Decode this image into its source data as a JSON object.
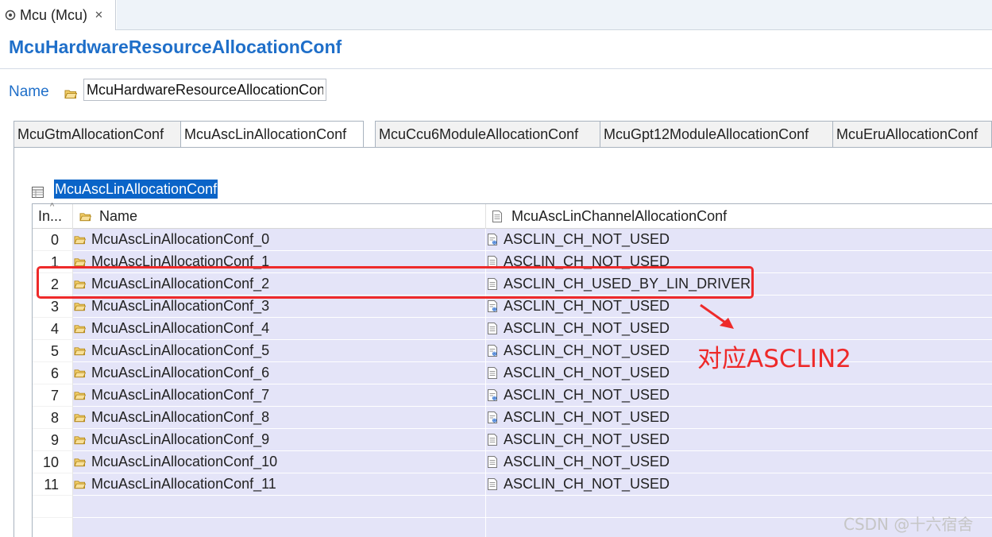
{
  "editor_tab": {
    "label": "Mcu (Mcu)",
    "close": "✕"
  },
  "page": {
    "title": "McuHardwareResourceAllocationConf"
  },
  "name_field": {
    "label": "Name",
    "value": "McuHardwareResourceAllocationConf"
  },
  "subtabs": [
    {
      "label": "McuGtmAllocationConf",
      "active": false
    },
    {
      "label": "McuAscLinAllocationConf",
      "active": true
    },
    {
      "label": "McuCcu6ModuleAllocationConf",
      "active": false
    },
    {
      "label": "McuGpt12ModuleAllocationConf",
      "active": false
    },
    {
      "label": "McuEruAllocationConf",
      "active": false
    }
  ],
  "section": {
    "title": "McuAscLinAllocationConf"
  },
  "table": {
    "columns": [
      "In...",
      "Name",
      "McuAscLinChannelAllocationConf"
    ],
    "rows": [
      {
        "index": "0",
        "name": "McuAscLinAllocationConf_0",
        "value": "ASCLIN_CH_NOT_USED",
        "icon": "document-default-icon"
      },
      {
        "index": "1",
        "name": "McuAscLinAllocationConf_1",
        "value": "ASCLIN_CH_NOT_USED",
        "icon": "document-icon"
      },
      {
        "index": "2",
        "name": "McuAscLinAllocationConf_2",
        "value": "ASCLIN_CH_USED_BY_LIN_DRIVER",
        "icon": "document-icon"
      },
      {
        "index": "3",
        "name": "McuAscLinAllocationConf_3",
        "value": "ASCLIN_CH_NOT_USED",
        "icon": "document-default-icon"
      },
      {
        "index": "4",
        "name": "McuAscLinAllocationConf_4",
        "value": "ASCLIN_CH_NOT_USED",
        "icon": "document-icon"
      },
      {
        "index": "5",
        "name": "McuAscLinAllocationConf_5",
        "value": "ASCLIN_CH_NOT_USED",
        "icon": "document-default-icon"
      },
      {
        "index": "6",
        "name": "McuAscLinAllocationConf_6",
        "value": "ASCLIN_CH_NOT_USED",
        "icon": "document-icon"
      },
      {
        "index": "7",
        "name": "McuAscLinAllocationConf_7",
        "value": "ASCLIN_CH_NOT_USED",
        "icon": "document-default-icon"
      },
      {
        "index": "8",
        "name": "McuAscLinAllocationConf_8",
        "value": "ASCLIN_CH_NOT_USED",
        "icon": "document-default-icon"
      },
      {
        "index": "9",
        "name": "McuAscLinAllocationConf_9",
        "value": "ASCLIN_CH_NOT_USED",
        "icon": "document-icon"
      },
      {
        "index": "10",
        "name": "McuAscLinAllocationConf_10",
        "value": "ASCLIN_CH_NOT_USED",
        "icon": "document-icon"
      },
      {
        "index": "11",
        "name": "McuAscLinAllocationConf_11",
        "value": "ASCLIN_CH_NOT_USED",
        "icon": "document-icon"
      }
    ]
  },
  "annotation": {
    "text": "对应ASCLIN2",
    "color": "#ee2a2a"
  },
  "watermark": "CSDN @十六宿舍",
  "colors": {
    "accent": "#1f6fc9",
    "selection": "#0a64c8",
    "row_bg": "#e4e4f8",
    "annotation": "#ee2a2a"
  }
}
